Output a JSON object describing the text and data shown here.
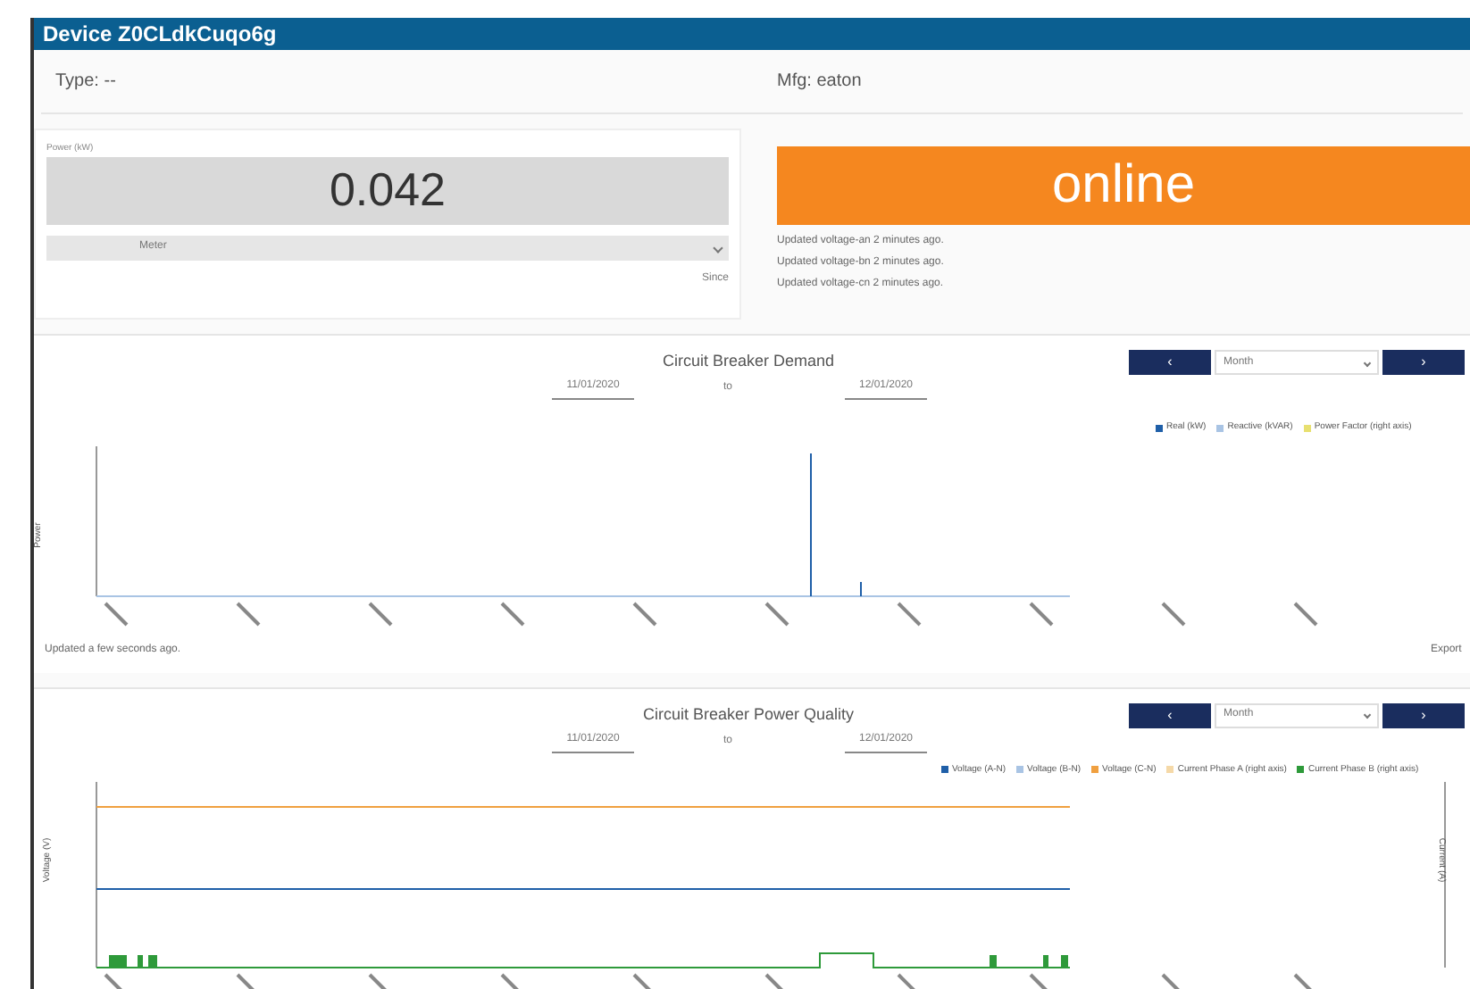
{
  "window": {
    "title": "Device Z0CLdkCuqo6g"
  },
  "info": {
    "type": "Type: --",
    "mfg": "Mfg: eaton"
  },
  "power": {
    "label": "Power (kW)",
    "value": "0.042",
    "select": "Meter",
    "since": "Since"
  },
  "status": {
    "text": "online",
    "updates": [
      "Updated voltage-an 2 minutes ago.",
      "Updated voltage-bn 2 minutes ago.",
      "Updated voltage-cn 2 minutes ago."
    ]
  },
  "charts": [
    {
      "kind": "demand",
      "title": "Circuit Breaker Demand",
      "from": "11/01/2020",
      "to_label": "to",
      "to": "12/01/2020",
      "prev": "‹",
      "period": "Month",
      "next": "›",
      "ylabel": "Power",
      "legend": [
        {
          "label": "Real (kW)",
          "color": "#1f5fa8"
        },
        {
          "label": "Reactive (kVAR)",
          "color": "#a9c4e4"
        },
        {
          "label": "Power Factor (right axis)",
          "color": "#e8e070"
        }
      ],
      "footer": "Updated a few seconds ago.",
      "export": "Export"
    },
    {
      "kind": "quality",
      "title": "Circuit Breaker Power Quality",
      "from": "11/01/2020",
      "to_label": "to",
      "to": "12/01/2020",
      "prev": "‹",
      "period": "Month",
      "next": "›",
      "ylabel": "Voltage (V)",
      "ylabel_right": "Current (A)",
      "legend": [
        {
          "label": "Voltage (A-N)",
          "color": "#1f5fa8"
        },
        {
          "label": "Voltage (B-N)",
          "color": "#a9c4e4"
        },
        {
          "label": "Voltage (C-N)",
          "color": "#f0a040"
        },
        {
          "label": "Current Phase A (right axis)",
          "color": "#f5d9a8"
        },
        {
          "label": "Current Phase B (right axis)",
          "color": "#2e9a3a"
        }
      ]
    }
  ]
}
